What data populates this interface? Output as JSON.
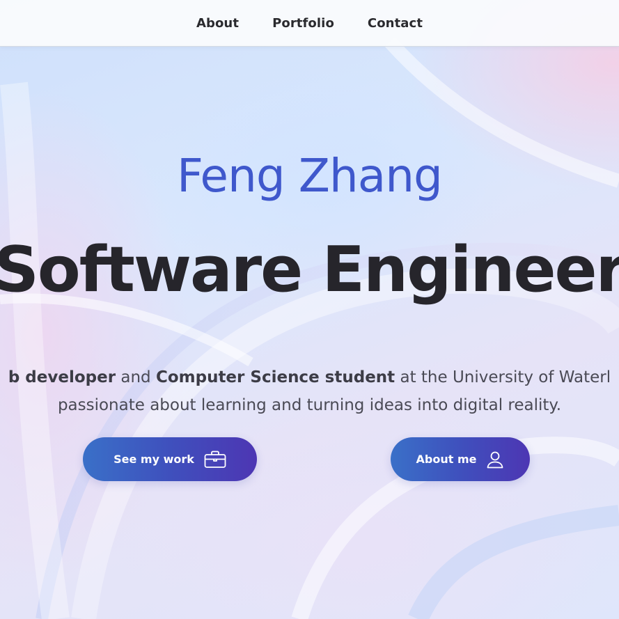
{
  "nav": {
    "items": [
      {
        "label": "About"
      },
      {
        "label": "Portfolio"
      },
      {
        "label": "Contact"
      }
    ]
  },
  "hero": {
    "name": "Feng Zhang",
    "title": "Software Engineer",
    "description": {
      "line1": {
        "bold1": "b developer",
        "text1": " and ",
        "bold2": "Computer Science student",
        "text2": " at the University of Waterl"
      },
      "line2": "passionate about learning and turning ideas into digital reality."
    },
    "buttons": {
      "work": {
        "label": "See my work",
        "icon": "briefcase-icon"
      },
      "about": {
        "label": "About me",
        "icon": "user-icon"
      }
    }
  },
  "colors": {
    "accent": "#3f58cc",
    "button_gradient_start": "#3a70c8",
    "button_gradient_end": "#4d36b3",
    "title": "#26252b"
  }
}
